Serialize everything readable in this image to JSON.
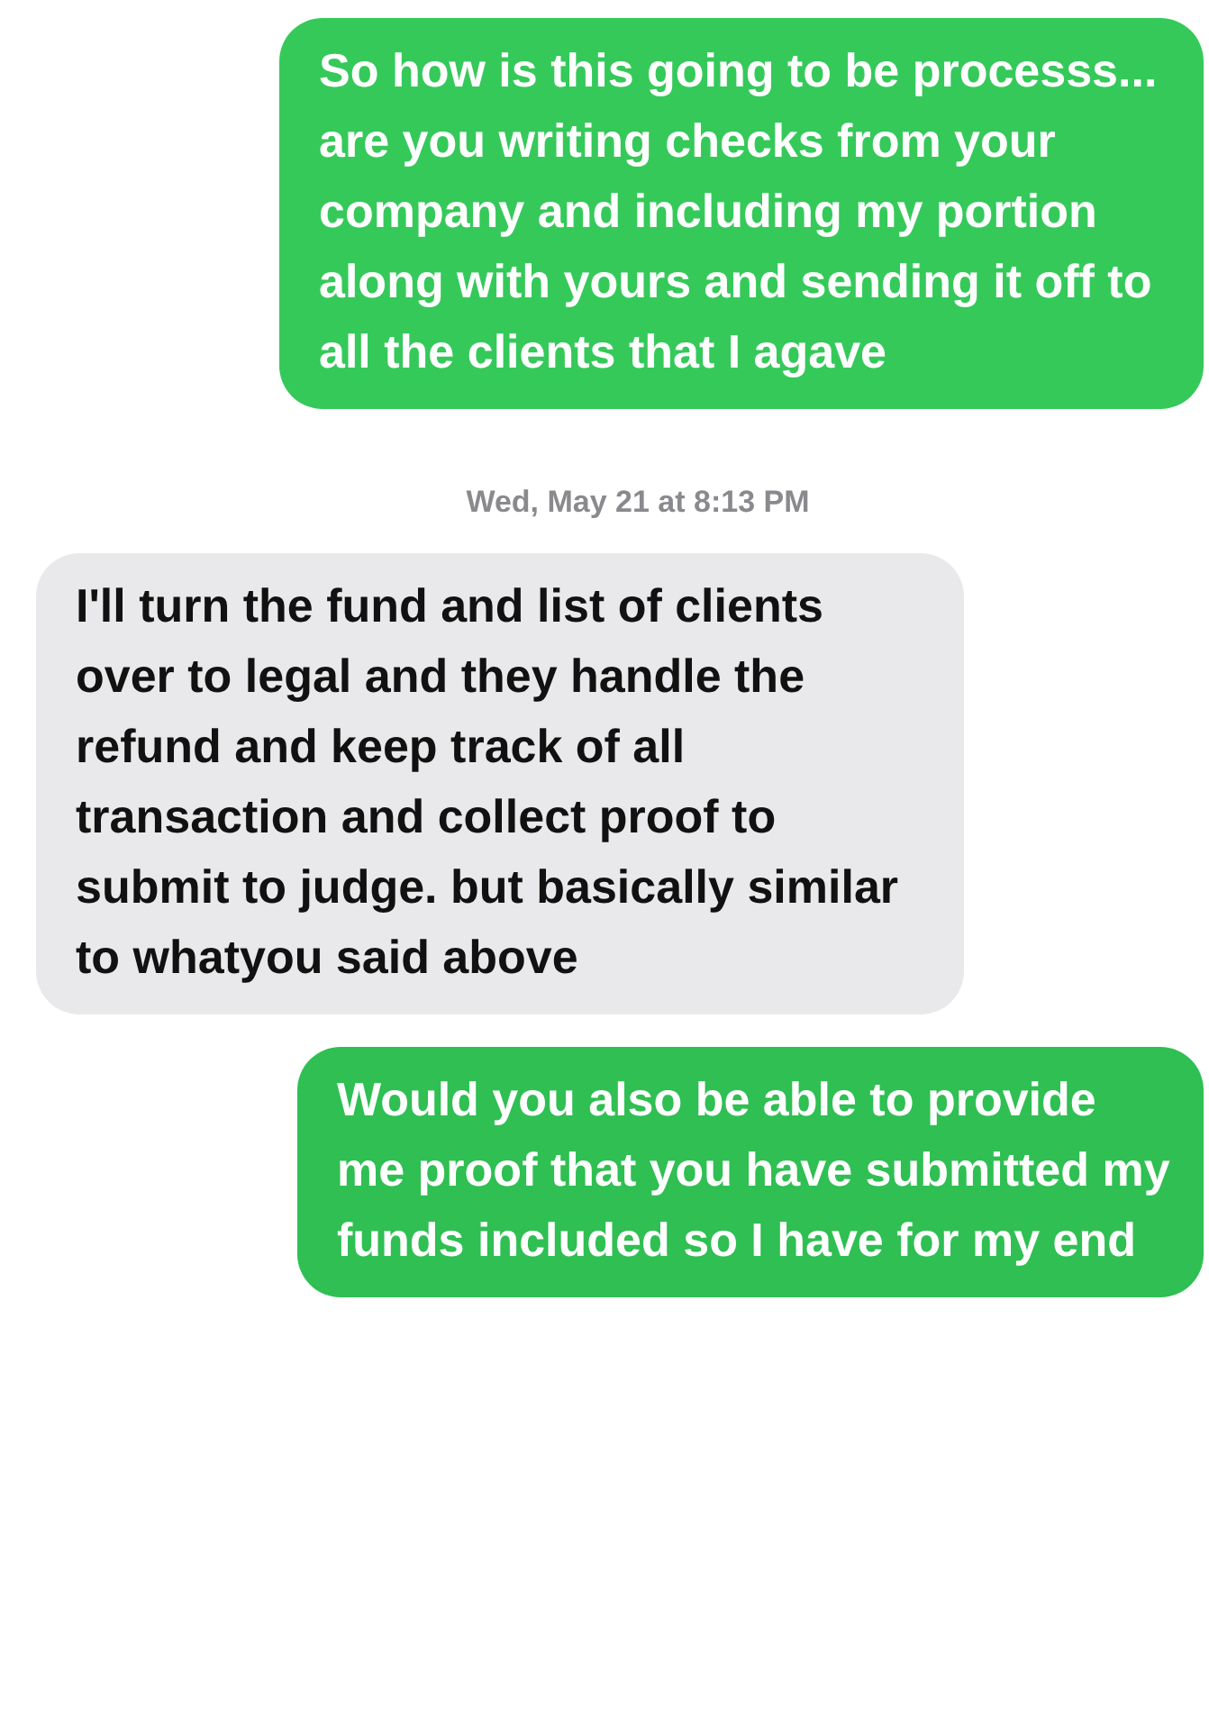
{
  "messages": [
    {
      "kind": "sent",
      "text": "So how is this going to be processs... are you writing checks from your company and including my portion along with yours and sending it off to all the clients that I agave"
    },
    {
      "kind": "timestamp",
      "text": "Wed, May 21 at 8:13 PM"
    },
    {
      "kind": "received",
      "text": "I'll turn the fund and list of clients over to legal and they handle the refund and keep track of all transaction and collect proof to submit to judge. but basically similar to whatyou said above"
    },
    {
      "kind": "sent",
      "text": "Would you also be able to provide me proof that you have submitted my funds included so I have for my end"
    }
  ]
}
